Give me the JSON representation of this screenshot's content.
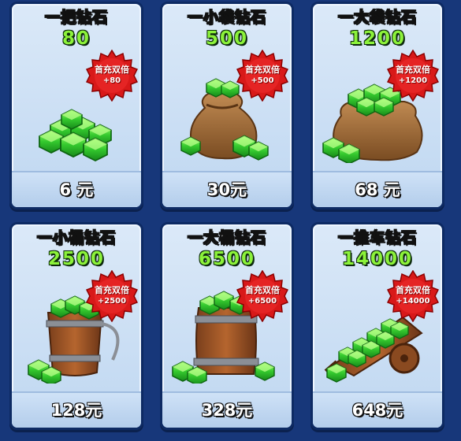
{
  "badge": {
    "line1": "首充双倍"
  },
  "cards": [
    {
      "title": "一把钻石",
      "amount": "80",
      "bonus": "+80",
      "price": "6 元",
      "art": "gem-pile-icon"
    },
    {
      "title": "一小袋钻石",
      "amount": "500",
      "bonus": "+500",
      "price": "30元",
      "art": "gem-small-bag-icon"
    },
    {
      "title": "一大袋钻石",
      "amount": "1200",
      "bonus": "+1200",
      "price": "68 元",
      "art": "gem-large-bag-icon"
    },
    {
      "title": "一小桶钻石",
      "amount": "2500",
      "bonus": "+2500",
      "price": "128元",
      "art": "gem-small-bucket-icon"
    },
    {
      "title": "一大桶钻石",
      "amount": "6500",
      "bonus": "+6500",
      "price": "328元",
      "art": "gem-barrel-icon"
    },
    {
      "title": "一推车钻石",
      "amount": "14000",
      "bonus": "+14000",
      "price": "648元",
      "art": "gem-cart-icon"
    }
  ],
  "colors": {
    "background": "#17377a",
    "gem": "#3fd43a",
    "badge": "#d81919",
    "amount": "#8cf23a"
  }
}
